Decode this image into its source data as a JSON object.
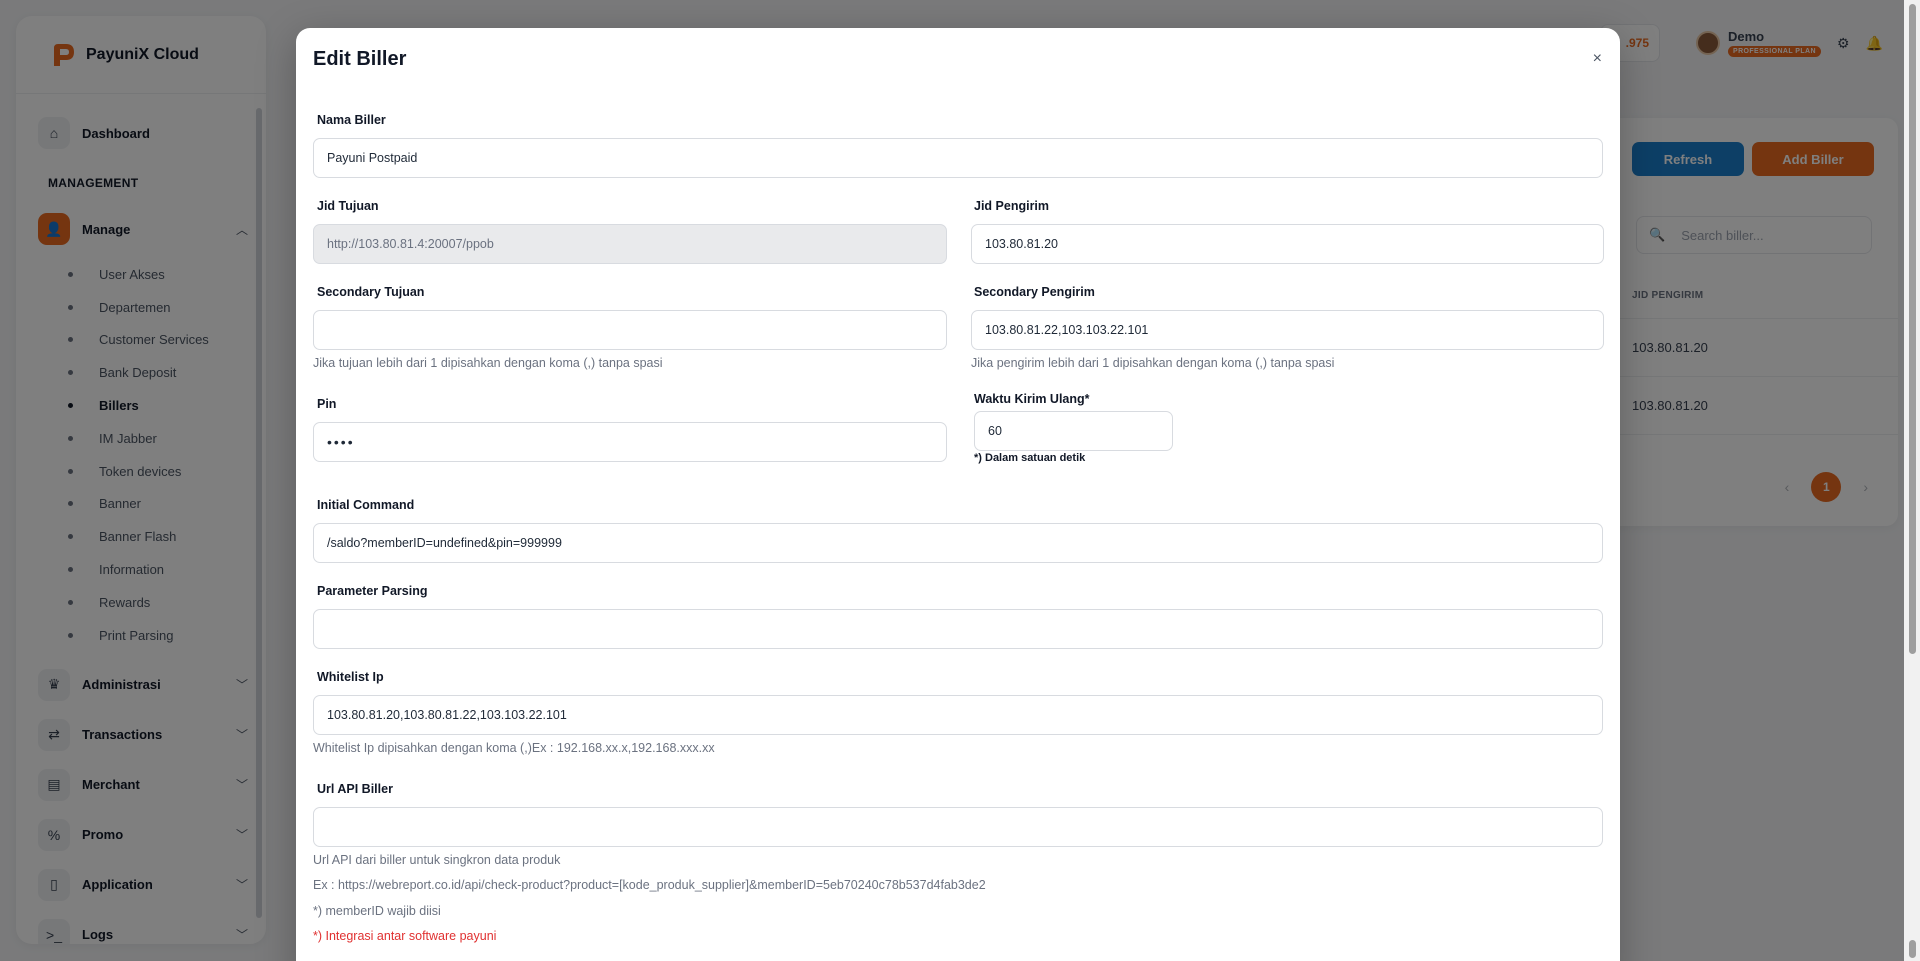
{
  "brand": {
    "name": "PayuniX Cloud"
  },
  "nav": {
    "dashboard": "Dashboard",
    "section_management": "MANAGEMENT",
    "manage": "Manage",
    "manage_items": [
      {
        "label": "User Akses",
        "active": false
      },
      {
        "label": "Departemen",
        "active": false
      },
      {
        "label": "Customer Services",
        "active": false
      },
      {
        "label": "Bank Deposit",
        "active": false
      },
      {
        "label": "Billers",
        "active": true
      },
      {
        "label": "IM Jabber",
        "active": false
      },
      {
        "label": "Token devices",
        "active": false
      },
      {
        "label": "Banner",
        "active": false
      },
      {
        "label": "Banner Flash",
        "active": false
      },
      {
        "label": "Information",
        "active": false
      },
      {
        "label": "Rewards",
        "active": false
      },
      {
        "label": "Print Parsing",
        "active": false
      }
    ],
    "groups": [
      "Administrasi",
      "Transactions",
      "Merchant",
      "Promo",
      "Application",
      "Logs"
    ]
  },
  "topbar": {
    "balance_partial": ".975",
    "user_name": "Demo",
    "user_plan": "PROFESSIONAL PLAN"
  },
  "billers_panel": {
    "refresh_label": "Refresh",
    "add_label": "Add Biller",
    "search_placeholder": "Search biller...",
    "column_header": "JID PENGIRIM",
    "rows": [
      "103.80.81.20",
      "103.80.81.20"
    ],
    "current_page": "1"
  },
  "modal": {
    "title": "Edit Biller",
    "close_symbol": "×",
    "fields": {
      "nama_biller": {
        "label": "Nama Biller",
        "value": "Payuni Postpaid"
      },
      "jid_tujuan": {
        "label": "Jid Tujuan",
        "value": "http://103.80.81.4:20007/ppob"
      },
      "jid_pengirim": {
        "label": "Jid Pengirim",
        "value": "103.80.81.20"
      },
      "secondary_tujuan": {
        "label": "Secondary Tujuan",
        "value": "",
        "help": "Jika tujuan lebih dari 1 dipisahkan dengan koma (,) tanpa spasi"
      },
      "secondary_pengirim": {
        "label": "Secondary Pengirim",
        "value": "103.80.81.22,103.103.22.101",
        "help": "Jika pengirim lebih dari 1 dipisahkan dengan koma (,) tanpa spasi"
      },
      "pin": {
        "label": "Pin",
        "value": "••••"
      },
      "waktu_kirim_ulang": {
        "label": "Waktu Kirim Ulang*",
        "value": "60",
        "note": "*) Dalam satuan detik"
      },
      "initial_command": {
        "label": "Initial Command",
        "value": "/saldo?memberID=undefined&pin=999999"
      },
      "parameter_parsing": {
        "label": "Parameter Parsing",
        "value": ""
      },
      "whitelist_ip": {
        "label": "Whitelist Ip",
        "value": "103.80.81.20,103.80.81.22,103.103.22.101",
        "help": "Whitelist Ip dipisahkan dengan koma (,)Ex : 192.168.xx.x,192.168.xxx.xx"
      },
      "url_api_biller": {
        "label": "Url API Biller",
        "value": "",
        "help1": "Url API dari biller untuk singkron data produk",
        "help2": "Ex : https://webreport.co.id/api/check-product?product=[kode_produk_supplier]&memberID=5eb70240c78b537d4fab3de2",
        "help3": "*) memberID wajib diisi",
        "help4": "*) Integrasi antar software payuni"
      }
    }
  }
}
